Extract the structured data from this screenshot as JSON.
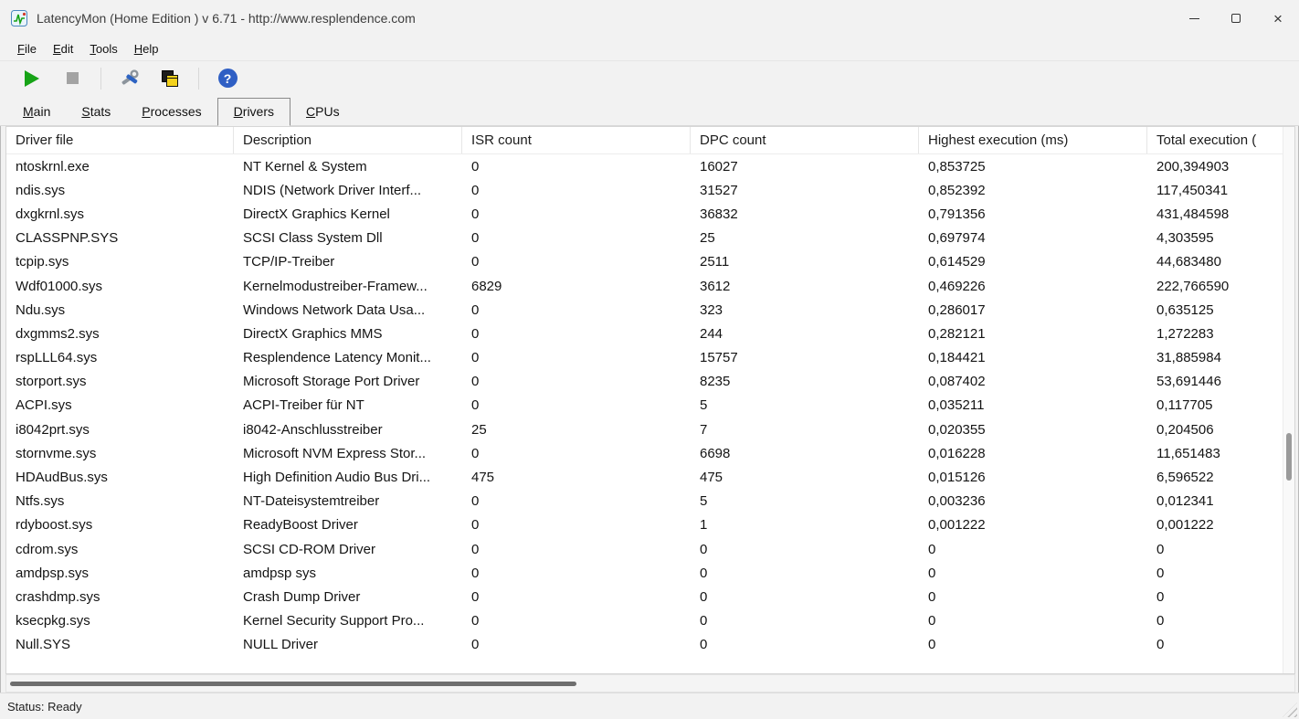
{
  "window": {
    "title": "LatencyMon  (Home Edition )  v 6.71 - http://www.resplendence.com",
    "controls": {
      "minimize": "minimize",
      "maximize": "maximize",
      "close": "×"
    }
  },
  "menu": {
    "items": [
      {
        "accel": "F",
        "rest": "ile"
      },
      {
        "accel": "E",
        "rest": "dit"
      },
      {
        "accel": "T",
        "rest": "ools"
      },
      {
        "accel": "H",
        "rest": "elp"
      }
    ]
  },
  "toolbar": {
    "icons": {
      "play": "green-play-triangle",
      "stop": "gray-stop-square",
      "tools": "tools-wrench",
      "cascade": "cascade-windows",
      "help": "?"
    }
  },
  "tabs": [
    {
      "accel": "M",
      "rest": "ain",
      "active": false
    },
    {
      "accel": "S",
      "rest": "tats",
      "active": false
    },
    {
      "accel": "P",
      "rest": "rocesses",
      "active": false
    },
    {
      "accel": "D",
      "rest": "rivers",
      "active": true
    },
    {
      "accel": "C",
      "rest": "PUs",
      "active": false
    }
  ],
  "table": {
    "columns": [
      "Driver file",
      "Description",
      "ISR count",
      "DPC count",
      "Highest execution (ms)",
      "Total execution ("
    ],
    "rows": [
      [
        "ntoskrnl.exe",
        "NT Kernel & System",
        "0",
        "16027",
        "0,853725",
        "200,394903"
      ],
      [
        "ndis.sys",
        "NDIS (Network Driver Interf...",
        "0",
        "31527",
        "0,852392",
        "117,450341"
      ],
      [
        "dxgkrnl.sys",
        "DirectX Graphics Kernel",
        "0",
        "36832",
        "0,791356",
        "431,484598"
      ],
      [
        "CLASSPNP.SYS",
        "SCSI Class System Dll",
        "0",
        "25",
        "0,697974",
        "4,303595"
      ],
      [
        "tcpip.sys",
        "TCP/IP-Treiber",
        "0",
        "2511",
        "0,614529",
        "44,683480"
      ],
      [
        "Wdf01000.sys",
        "Kernelmodustreiber-Framew...",
        "6829",
        "3612",
        "0,469226",
        "222,766590"
      ],
      [
        "Ndu.sys",
        "Windows Network Data Usa...",
        "0",
        "323",
        "0,286017",
        "0,635125"
      ],
      [
        "dxgmms2.sys",
        "DirectX Graphics MMS",
        "0",
        "244",
        "0,282121",
        "1,272283"
      ],
      [
        "rspLLL64.sys",
        "Resplendence Latency Monit...",
        "0",
        "15757",
        "0,184421",
        "31,885984"
      ],
      [
        "storport.sys",
        "Microsoft Storage Port Driver",
        "0",
        "8235",
        "0,087402",
        "53,691446"
      ],
      [
        "ACPI.sys",
        "ACPI-Treiber für NT",
        "0",
        "5",
        "0,035211",
        "0,117705"
      ],
      [
        "i8042prt.sys",
        "i8042-Anschlusstreiber",
        "25",
        "7",
        "0,020355",
        "0,204506"
      ],
      [
        "stornvme.sys",
        "Microsoft NVM Express Stor...",
        "0",
        "6698",
        "0,016228",
        "11,651483"
      ],
      [
        "HDAudBus.sys",
        "High Definition Audio Bus Dri...",
        "475",
        "475",
        "0,015126",
        "6,596522"
      ],
      [
        "Ntfs.sys",
        "NT-Dateisystemtreiber",
        "0",
        "5",
        "0,003236",
        "0,012341"
      ],
      [
        "rdyboost.sys",
        "ReadyBoost Driver",
        "0",
        "1",
        "0,001222",
        "0,001222"
      ],
      [
        "cdrom.sys",
        "SCSI CD-ROM Driver",
        "0",
        "0",
        "0",
        "0"
      ],
      [
        "amdpsp.sys",
        "amdpsp sys",
        "0",
        "0",
        "0",
        "0"
      ],
      [
        "crashdmp.sys",
        "Crash Dump Driver",
        "0",
        "0",
        "0",
        "0"
      ],
      [
        "ksecpkg.sys",
        "Kernel Security Support Pro...",
        "0",
        "0",
        "0",
        "0"
      ],
      [
        "Null.SYS",
        "NULL Driver",
        "0",
        "0",
        "0",
        "0"
      ]
    ]
  },
  "status_bar": {
    "text": "Status: Ready"
  }
}
